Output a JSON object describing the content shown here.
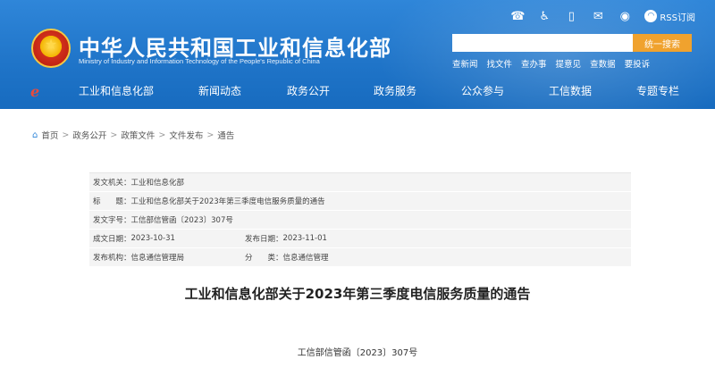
{
  "header": {
    "title": "中华人民共和国工业和信息化部",
    "subtitle": "Ministry of Industry and Information Technology of the People's Republic of China",
    "rss_label": "RSS订阅",
    "tool_icons": [
      "phone-icon",
      "accessibility-icon",
      "mobile-icon",
      "mail-icon",
      "weibo-icon"
    ],
    "search": {
      "placeholder": "",
      "button_label": "统一搜索"
    },
    "quick_links": [
      "查新闻",
      "找文件",
      "查办事",
      "提意见",
      "查数据",
      "要投诉"
    ]
  },
  "nav": {
    "items": [
      "工业和信息化部",
      "新闻动态",
      "政务公开",
      "政务服务",
      "公众参与",
      "工信数据",
      "专题专栏"
    ]
  },
  "breadcrumb": [
    "首页",
    "政务公开",
    "政策文件",
    "文件发布",
    "通告"
  ],
  "meta": {
    "issuer_label": "发文机关：",
    "issuer": "工业和信息化部",
    "title_label": "标　　题：",
    "title": "工业和信息化部关于2023年第三季度电信服务质量的通告",
    "doc_no_label": "发文字号：",
    "doc_no": "工信部信管函〔2023〕307号",
    "created_label": "成文日期：",
    "created": "2023-10-31",
    "published_label": "发布日期：",
    "published": "2023-11-01",
    "agency_label": "发布机构：",
    "agency": "信息通信管理局",
    "category_label": "分　　类：",
    "category": "信息通信管理"
  },
  "document": {
    "title": "工业和信息化部关于2023年第三季度电信服务质量的通告",
    "number": "工信部信管函〔2023〕307号"
  },
  "colors": {
    "header_blue": "#1f74c8",
    "search_button": "#f0a22e",
    "meta_bg": "#f4f4f4"
  }
}
